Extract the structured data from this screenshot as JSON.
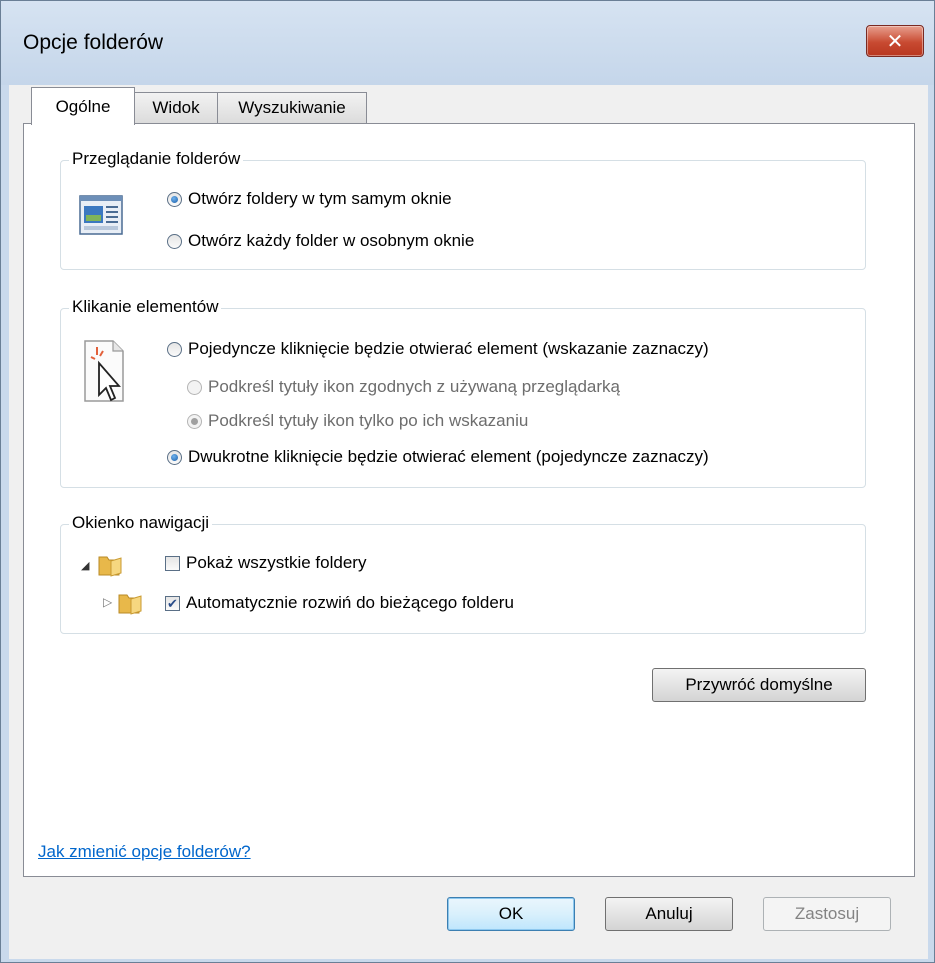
{
  "window": {
    "title": "Opcje folderów",
    "close_label": "✕"
  },
  "tabs": [
    {
      "label": "Ogólne",
      "active": true
    },
    {
      "label": "Widok",
      "active": false
    },
    {
      "label": "Wyszukiwanie",
      "active": false
    }
  ],
  "browse_group": {
    "label": "Przeglądanie folderów",
    "options": [
      {
        "label": "Otwórz foldery w tym samym oknie",
        "checked": true
      },
      {
        "label": "Otwórz każdy folder w osobnym oknie",
        "checked": false
      }
    ]
  },
  "click_group": {
    "label": "Klikanie elementów",
    "single_click": {
      "label": "Pojedyncze kliknięcie będzie otwierać element (wskazanie zaznaczy)",
      "checked": false
    },
    "underline_browser": {
      "label": "Podkreśl tytuły ikon zgodnych z używaną przeglądarką",
      "checked": false,
      "disabled": true
    },
    "underline_hover": {
      "label": "Podkreśl tytuły ikon tylko po ich wskazaniu",
      "checked": true,
      "disabled": true
    },
    "double_click": {
      "label": "Dwukrotne kliknięcie będzie otwierać element (pojedyncze zaznaczy)",
      "checked": true
    }
  },
  "nav_group": {
    "label": "Okienko nawigacji",
    "show_all": {
      "label": "Pokaż wszystkie foldery",
      "checked": false
    },
    "auto_expand": {
      "label": "Automatycznie rozwiń do bieżącego folderu",
      "checked": true
    }
  },
  "restore_button": "Przywróć domyślne",
  "help_link": "Jak zmienić opcje folderów?",
  "buttons": {
    "ok": "OK",
    "cancel": "Anuluj",
    "apply": "Zastosuj"
  }
}
